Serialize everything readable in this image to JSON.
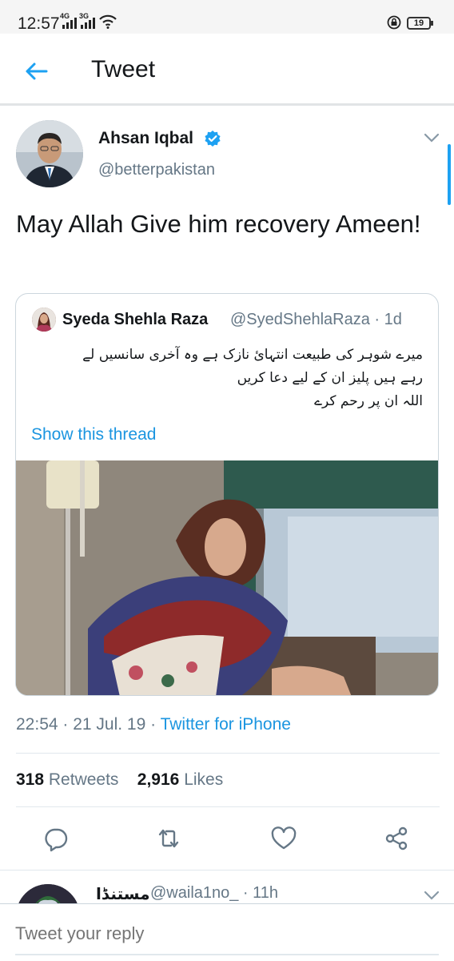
{
  "status_bar": {
    "time": "12:57",
    "net1": "4G",
    "net2": "3G",
    "battery": "19"
  },
  "header": {
    "title": "Tweet"
  },
  "tweet": {
    "author_name": "Ahsan Iqbal",
    "author_handle": "@betterpakistan",
    "text": "May Allah Give him recovery Ameen!",
    "timestamp": "22:54 · 21 Jul. 19 · ",
    "source": "Twitter for iPhone",
    "retweets_count": "318",
    "retweets_label": "Retweets",
    "likes_count": "2,916",
    "likes_label": "Likes"
  },
  "quote": {
    "author_name": "Syeda Shehla Raza",
    "handle_time": "@SyedShehlaRaza · 1d",
    "text_lines": [
      "میرے شوہر کی طبیعت انتہائ نازک ہے وہ آخری سانسیں لے",
      "رہے ہیں پلیز ان کے لیے دعا کریں",
      "اللہ ان پر رحم کرے"
    ],
    "show_thread": "Show this thread"
  },
  "reply_preview": {
    "name": "مستنڈا",
    "handle_time": "@waila1no_ · 11h"
  },
  "composer": {
    "placeholder": "Tweet your reply"
  },
  "colors": {
    "accent": "#1da1f2",
    "link": "#1b95e0",
    "secondary_text": "#657786"
  },
  "icons": {
    "back": "arrow-left-icon",
    "verified": "verified-badge-icon",
    "menu": "chevron-down-icon",
    "reply": "reply-icon",
    "retweet": "retweet-icon",
    "like": "heart-icon",
    "share": "share-icon"
  }
}
